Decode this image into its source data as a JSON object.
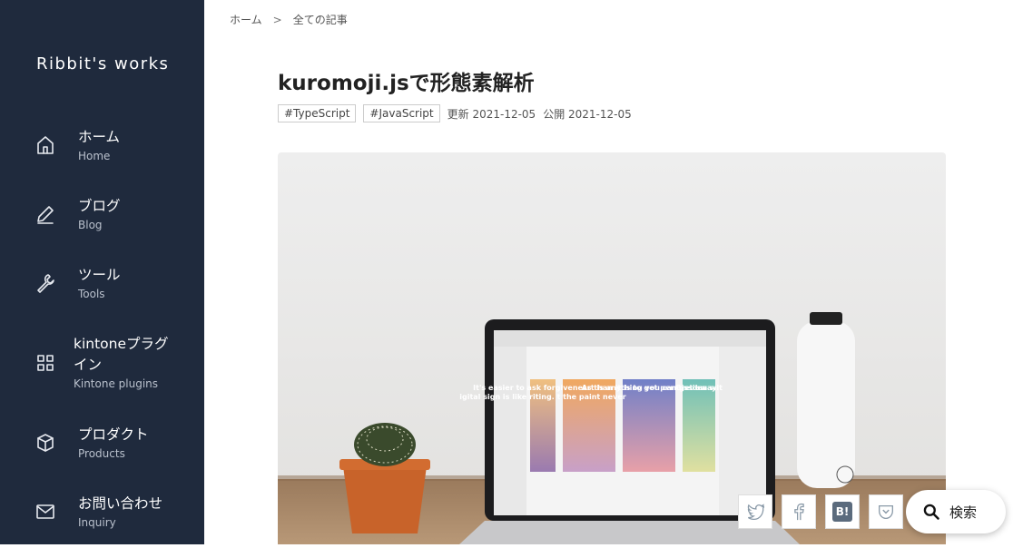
{
  "site": {
    "title": "Ribbit's works"
  },
  "nav": {
    "items": [
      {
        "label": "ホーム",
        "sub": "Home",
        "icon": "home-icon"
      },
      {
        "label": "ブログ",
        "sub": "Blog",
        "icon": "pencil-icon"
      },
      {
        "label": "ツール",
        "sub": "Tools",
        "icon": "wrench-icon"
      },
      {
        "label": "kintoneプラグイン",
        "sub": "Kintone plugins",
        "icon": "grid-icon"
      },
      {
        "label": "プロダクト",
        "sub": "Products",
        "icon": "box-icon"
      },
      {
        "label": "お問い合わせ",
        "sub": "Inquiry",
        "icon": "mail-icon"
      }
    ]
  },
  "breadcrumb": {
    "home": "ホーム",
    "separator": ">",
    "current": "全ての記事"
  },
  "article": {
    "title": "kuromoji.jsで形態素解析",
    "tags": [
      "#TypeScript",
      "#JavaScript"
    ],
    "updated": "更新 2021-12-05",
    "published": "公開 2021-12-05"
  },
  "hero_image": {
    "posters": [
      "igital sign is like riting. t the paint never",
      "It's easier to ask forgiveness than it is to get permission",
      "Art is anything you can get away",
      "Gre dea wit"
    ]
  },
  "share": {
    "hatena_label": "B!"
  },
  "search": {
    "label": "検索"
  },
  "colors": {
    "sidebar": "#1f2a3d",
    "accent": "#ffffff"
  }
}
